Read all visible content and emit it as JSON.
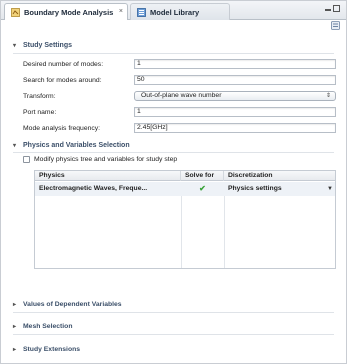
{
  "tabs": [
    {
      "label": "Boundary Mode Analysis",
      "icon": "study-icon",
      "active": true
    },
    {
      "label": "Model Library",
      "icon": "library-icon",
      "active": false
    }
  ],
  "study_settings": {
    "header": "Study Settings",
    "fields": {
      "desired_modes_label": "Desired number of modes:",
      "desired_modes_value": "1",
      "search_around_label": "Search for modes around:",
      "search_around_value": "50",
      "transform_label": "Transform:",
      "transform_value": "Out-of-plane wave number",
      "port_name_label": "Port name:",
      "port_name_value": "1",
      "frequency_label": "Mode analysis frequency:",
      "frequency_value": "2.45[GHz]"
    }
  },
  "physics": {
    "header": "Physics and Variables Selection",
    "modify_label": "Modify physics tree and variables for study step",
    "modify_checked": false,
    "columns": [
      "Physics",
      "Solve for",
      "Discretization"
    ],
    "rows": [
      {
        "physics": "Electromagnetic Waves, Freque...",
        "solve_for": "✔",
        "discretization": "Physics settings"
      }
    ]
  },
  "collapsed_sections": [
    {
      "label": "Values of Dependent Variables"
    },
    {
      "label": "Mesh Selection"
    },
    {
      "label": "Study Extensions"
    }
  ],
  "colors": {
    "accent": "#3b4f69",
    "check": "#3aa33a"
  }
}
